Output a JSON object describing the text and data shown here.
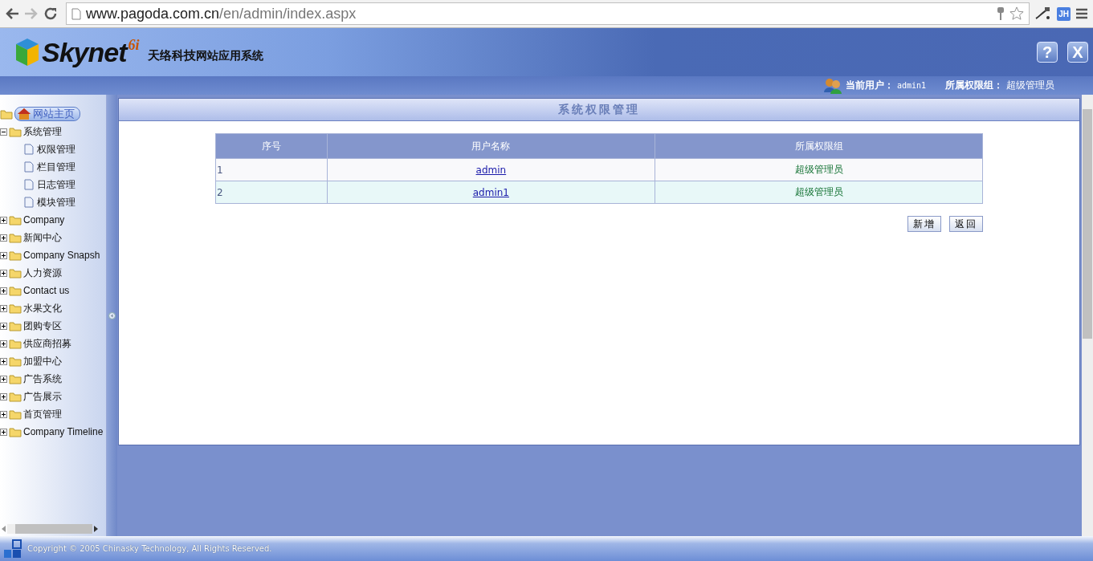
{
  "browser": {
    "url_host": "www.pagoda.com.cn",
    "url_path": "/en/admin/index.aspx",
    "extension_label": "JH"
  },
  "header": {
    "logo_text": "Skynet",
    "logo_sup": "6i",
    "company": "天络科技",
    "system": "网站应用系统",
    "user_label": "当前用户：",
    "user": "admin1",
    "group_label": "所属权限组：",
    "group": "超级管理员",
    "buttons": [
      "?",
      "X"
    ]
  },
  "sidebar": {
    "home": "网站主页",
    "tree": [
      {
        "label": "系统管理",
        "expanded": true,
        "children": [
          {
            "label": "权限管理"
          },
          {
            "label": "栏目管理"
          },
          {
            "label": "日志管理"
          },
          {
            "label": "模块管理"
          }
        ]
      },
      {
        "label": "Company",
        "expanded": false
      },
      {
        "label": "新闻中心",
        "expanded": false
      },
      {
        "label": "Company Snapsh",
        "expanded": false
      },
      {
        "label": "人力资源",
        "expanded": false
      },
      {
        "label": "Contact us",
        "expanded": false
      },
      {
        "label": "水果文化",
        "expanded": false
      },
      {
        "label": "团购专区",
        "expanded": false
      },
      {
        "label": "供应商招募",
        "expanded": false
      },
      {
        "label": "加盟中心",
        "expanded": false
      },
      {
        "label": "广告系统",
        "expanded": false
      },
      {
        "label": "广告展示",
        "expanded": false
      },
      {
        "label": "首页管理",
        "expanded": false
      },
      {
        "label": "Company Timeline",
        "expanded": false
      }
    ]
  },
  "content": {
    "title": "系统权限管理",
    "table": {
      "columns": [
        "序号",
        "用户名称",
        "所属权限组"
      ],
      "rows": [
        {
          "no": "1",
          "user": "admin",
          "group": "超级管理员"
        },
        {
          "no": "2",
          "user": "admin1",
          "group": "超级管理员"
        }
      ]
    },
    "buttons": [
      "新增",
      "返回"
    ]
  },
  "footer": {
    "copyright": "Copyright © 2005 Chinasky Technology, All Rights Reserved."
  }
}
